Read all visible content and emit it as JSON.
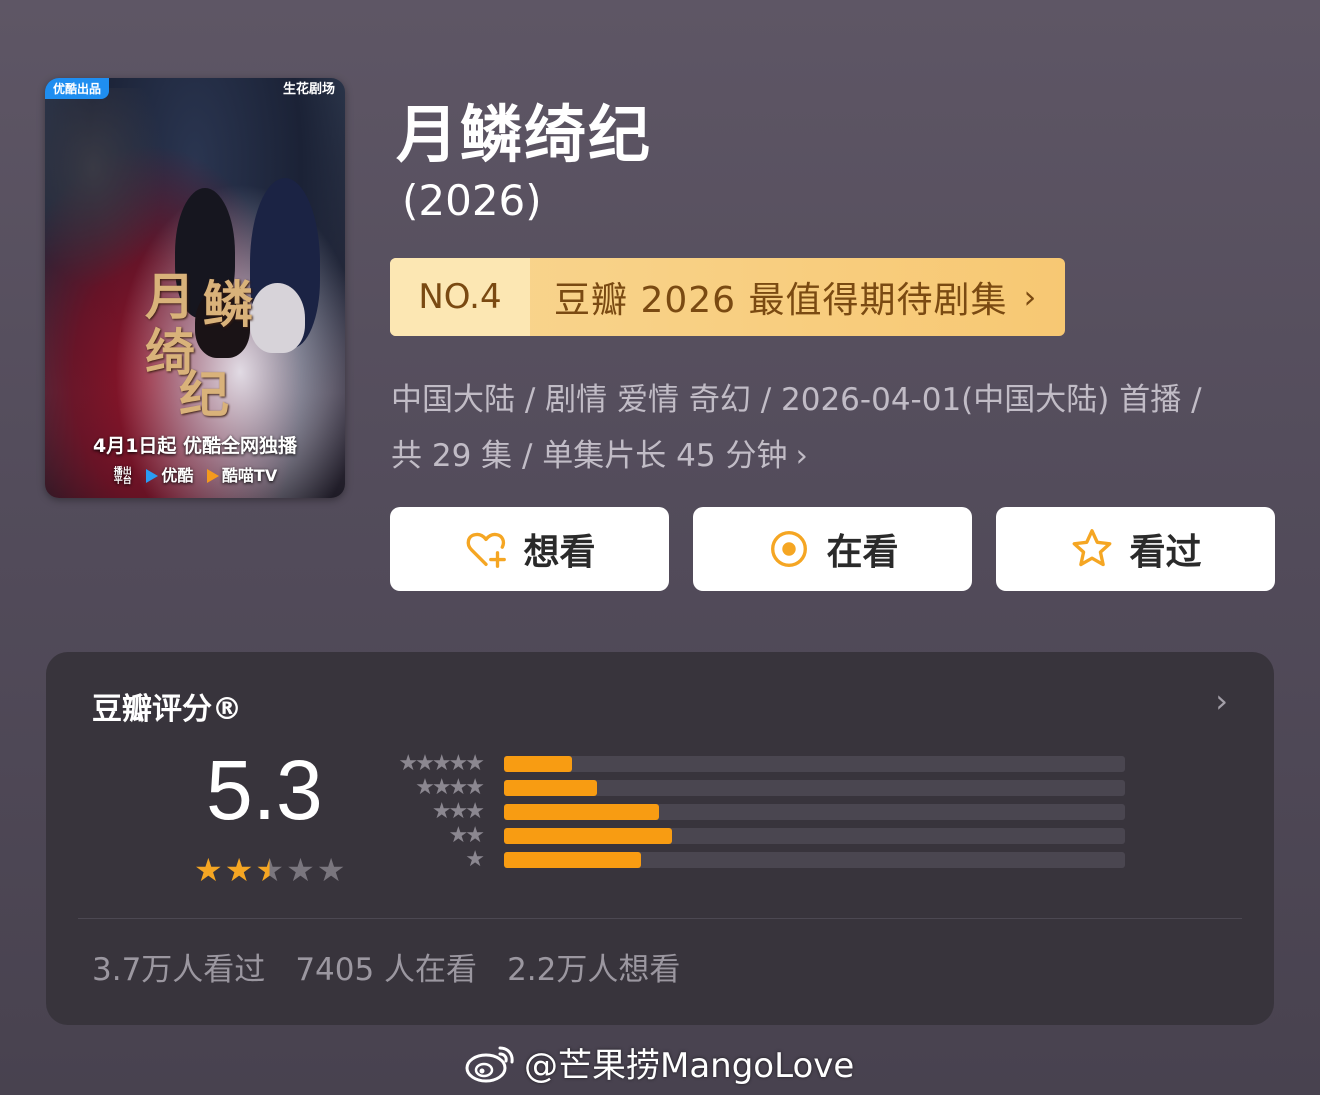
{
  "poster": {
    "brand_left": "优酷出品",
    "brand_right": "生花剧场",
    "calligraphy": [
      "月",
      "鳞",
      "绮",
      "纪"
    ],
    "release": "4月1日起 优酷全网独播",
    "platform_note": "播出平台",
    "platform_1": "优酷",
    "platform_2": "酷喵TV"
  },
  "title": "月鳞绮纪",
  "year": "(2026)",
  "rank": {
    "number": "NO.4",
    "text": "豆瓣 2026 最值得期待剧集",
    "chevron": "›"
  },
  "meta": {
    "line1": "中国大陆 / 剧情 爱情 奇幻 / 2026-04-01(中国大陆) 首播 /",
    "line2": "共 29 集 / 单集片长 45 分钟",
    "chevron": "›"
  },
  "actions": {
    "want": "想看",
    "watching": "在看",
    "watched": "看过",
    "accent_color": "#f5a623"
  },
  "rating": {
    "label": "豆瓣评分®",
    "chevron": "›",
    "score": "5.3",
    "stars_value": 2.5,
    "stars_max": 5,
    "distribution": [
      {
        "stars": 5,
        "stars_text": "★★★★★",
        "fraction": 0.11
      },
      {
        "stars": 4,
        "stars_text": "★★★★",
        "fraction": 0.15
      },
      {
        "stars": 3,
        "stars_text": "★★★",
        "fraction": 0.25
      },
      {
        "stars": 2,
        "stars_text": "★★",
        "fraction": 0.27
      },
      {
        "stars": 1,
        "stars_text": "★",
        "fraction": 0.22
      }
    ],
    "bar_color": "#f89c12"
  },
  "stats": {
    "watched": "3.7万人看过",
    "watching": "7405 人在看",
    "want": "2.2万人想看"
  },
  "watermark": {
    "text": "@芒果捞MangoLove",
    "icon": "weibo-icon"
  }
}
